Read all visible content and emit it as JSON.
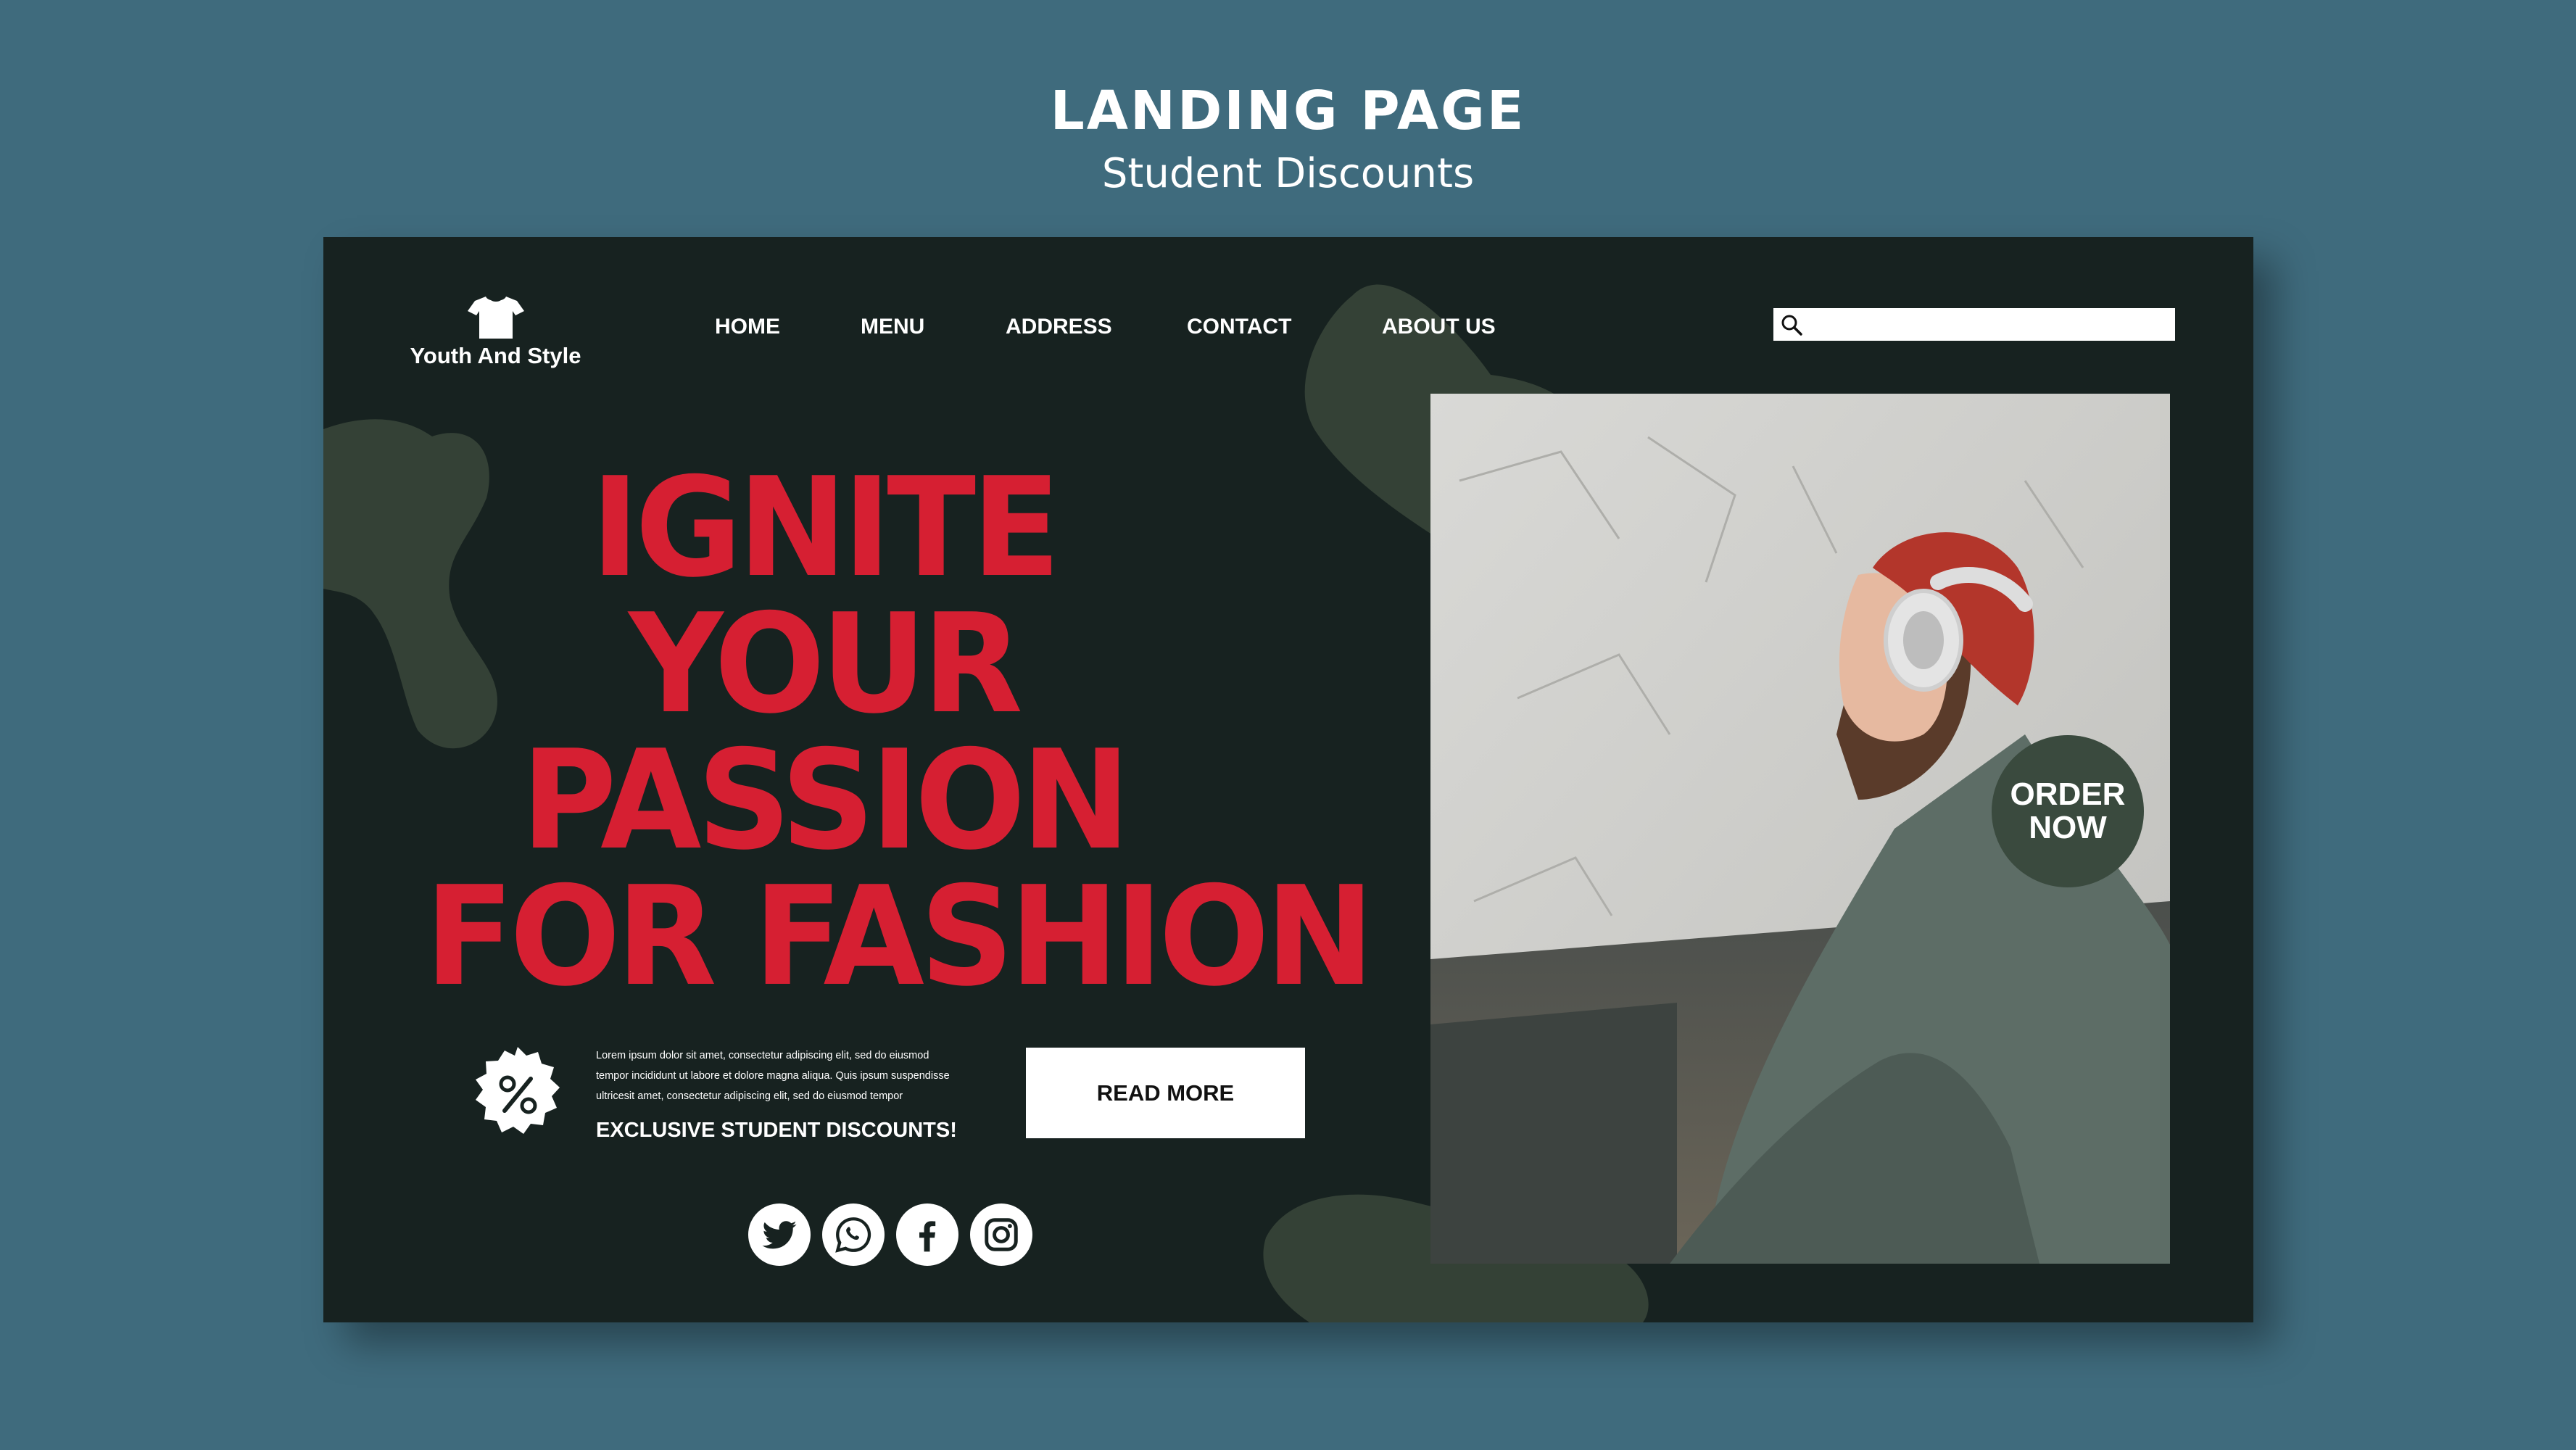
{
  "header": {
    "title": "LANDING PAGE",
    "subtitle": "Student Discounts"
  },
  "brand": {
    "name": "Youth And Style",
    "icon": "tshirt-icon"
  },
  "nav": {
    "items": [
      {
        "label": "HOME"
      },
      {
        "label": "MENU"
      },
      {
        "label": "ADDRESS"
      },
      {
        "label": "CONTACT"
      },
      {
        "label": "ABOUT US"
      }
    ]
  },
  "search": {
    "placeholder": "",
    "value": "",
    "icon": "search-icon"
  },
  "hero": {
    "headline_lines": [
      "IGNITE",
      "YOUR",
      "PASSION",
      "FOR FASHION"
    ],
    "body_lines": [
      "Lorem ipsum dolor sit amet, consectetur adipiscing elit, sed do eiusmod",
      "tempor incididunt ut labore et dolore magna aliqua. Quis ipsum suspendisse",
      "ultricesit amet, consectetur adipiscing elit, sed do eiusmod tempor"
    ],
    "promo_title": "EXCLUSIVE STUDENT DISCOUNTS!",
    "cta_label": "READ MORE",
    "badge_icon": "percent-badge-icon"
  },
  "order_badge": {
    "line1": "ORDER",
    "line2": "NOW"
  },
  "socials": [
    "twitter-icon",
    "whatsapp-icon",
    "facebook-icon",
    "instagram-icon"
  ],
  "colors": {
    "background": "#3f6b7d",
    "panel": "#172220",
    "accent": "#d61f32",
    "blob": "#344136",
    "badge": "#3a4a3e"
  }
}
